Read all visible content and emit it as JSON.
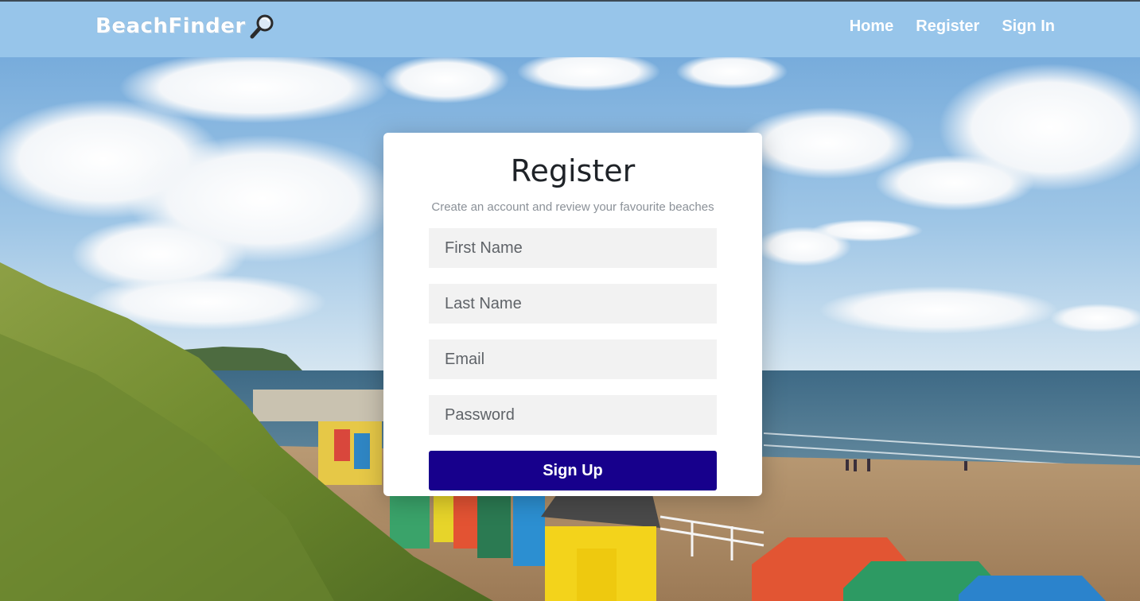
{
  "header": {
    "brand": "BeachFinder",
    "brand_icon": "magnifying-glass-icon",
    "nav": [
      {
        "label": "Home"
      },
      {
        "label": "Register"
      },
      {
        "label": "Sign In"
      }
    ]
  },
  "form": {
    "title": "Register",
    "subtitle": "Create an account and review your favourite beaches",
    "fields": [
      {
        "placeholder": "First Name",
        "value": ""
      },
      {
        "placeholder": "Last Name",
        "value": ""
      },
      {
        "placeholder": "Email",
        "value": ""
      },
      {
        "placeholder": "Password",
        "value": ""
      }
    ],
    "submit_label": "Sign Up"
  },
  "colors": {
    "header_bg": "#97c5ea",
    "button_bg": "#17008c",
    "card_bg": "#ffffff",
    "field_bg": "#f2f2f2"
  }
}
